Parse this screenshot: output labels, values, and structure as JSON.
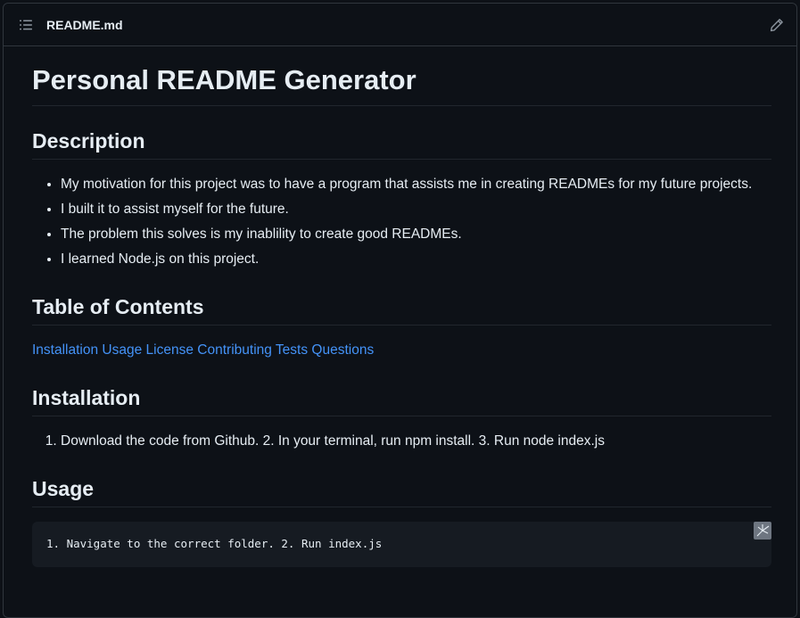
{
  "header": {
    "file_name": "README.md",
    "toc_icon": "list-unordered-icon",
    "edit_icon": "pencil-icon"
  },
  "readme": {
    "title": "Personal README Generator",
    "description": {
      "heading": "Description",
      "items": [
        "My motivation for this project was to have a program that assists me in creating READMEs for my future projects.",
        "I built it to assist myself for the future.",
        "The problem this solves is my inablility to create good READMEs.",
        "I learned Node.js on this project."
      ]
    },
    "toc": {
      "heading": "Table of Contents",
      "links": [
        "Installation",
        "Usage",
        "License",
        "Contributing",
        "Tests",
        "Questions"
      ]
    },
    "installation": {
      "heading": "Installation",
      "steps": [
        "Download the code from Github. 2. In your terminal, run npm install. 3. Run node index.js"
      ]
    },
    "usage": {
      "heading": "Usage",
      "code": "1. Navigate to the correct folder. 2. Run index.js"
    }
  },
  "colors": {
    "background": "#0d1117",
    "border": "#30363d",
    "text": "#e6edf3",
    "link": "#4493f8",
    "code_bg": "#161b22"
  }
}
